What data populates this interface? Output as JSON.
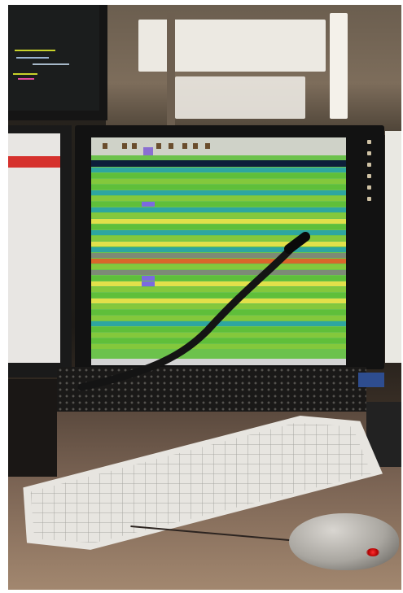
{
  "scene": {
    "kind": "photo",
    "palette": {
      "screen_green": "#6cc24c",
      "header_navy": "#0d1e3a",
      "highlight_purple": "#7b6ae0",
      "row_yellow": "#e2e04a",
      "row_teal": "#2ea6a0",
      "row_orange": "#d9662a",
      "row_gray": "#7d8a76",
      "alert_red": "#d6312d",
      "led_red": "#ff3030"
    }
  },
  "main_monitor": {
    "table_rows": [
      {
        "color": "#2ea6a0"
      },
      {
        "color": "#5fbf3a"
      },
      {
        "color": "#84c83c"
      },
      {
        "color": "#5fbf3a"
      },
      {
        "color": "#2ea6a0"
      },
      {
        "color": "#84c83c"
      },
      {
        "color": "#5fbf3a"
      },
      {
        "color": "#2ea6a0"
      },
      {
        "color": "#84c83c"
      },
      {
        "color": "#e2e04a"
      },
      {
        "color": "#5fbf3a"
      },
      {
        "color": "#2ea6a0"
      },
      {
        "color": "#84c83c"
      },
      {
        "color": "#e2e04a"
      },
      {
        "color": "#2ea6a0"
      },
      {
        "color": "#7d8a76"
      },
      {
        "color": "#d9662a"
      },
      {
        "color": "#84c83c"
      },
      {
        "color": "#7d8a76"
      },
      {
        "color": "#5fbf3a"
      },
      {
        "color": "#e2e04a"
      },
      {
        "color": "#84c83c"
      },
      {
        "color": "#5fbf3a"
      },
      {
        "color": "#e2e04a"
      },
      {
        "color": "#84c83c"
      },
      {
        "color": "#5fbf3a"
      },
      {
        "color": "#84c83c"
      },
      {
        "color": "#2ea6a0"
      },
      {
        "color": "#5fbf3a"
      },
      {
        "color": "#84c83c"
      },
      {
        "color": "#5fbf3a"
      },
      {
        "color": "#84c83c"
      }
    ]
  }
}
